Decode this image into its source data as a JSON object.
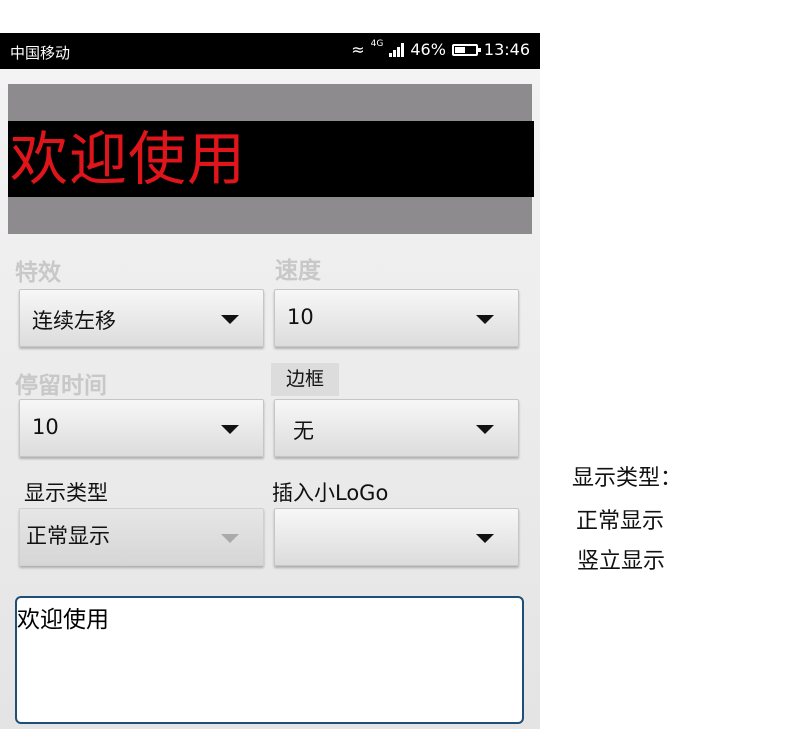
{
  "statusbar": {
    "carrier": "中国移动",
    "network": "4G",
    "battery": "46%",
    "time": "13:46"
  },
  "banner": {
    "led_text": "欢迎使用"
  },
  "effect": {
    "label": "特效",
    "value": "连续左移"
  },
  "speed": {
    "label": "速度",
    "value": "10"
  },
  "dwell": {
    "label": "停留时间",
    "value": "10"
  },
  "border": {
    "label": "边框",
    "value": "无"
  },
  "display_type": {
    "label": "显示类型",
    "value": "正常显示"
  },
  "logo": {
    "label": "插入小LoGo",
    "value": ""
  },
  "message": {
    "text": "欢迎使用"
  },
  "note": {
    "title": "显示类型：",
    "options": [
      "正常显示",
      "竖立显示"
    ]
  },
  "colors": {
    "led_text": "#e0151b",
    "banner_bg": "#8e8b8e",
    "input_border": "#1f4e78"
  }
}
